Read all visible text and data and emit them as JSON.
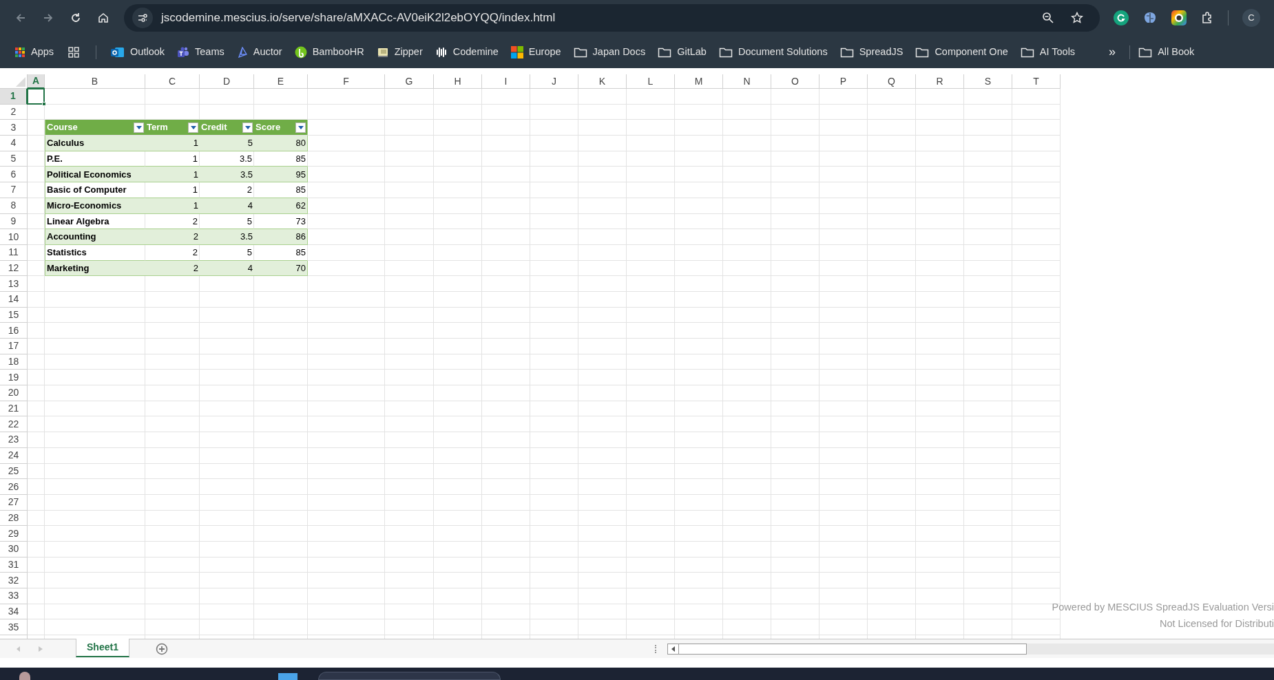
{
  "browser": {
    "url": "jscodemine.mescius.io/serve/share/aMXACc-AV0eiK2l2ebOYQQ/index.html",
    "back_disabled": true,
    "profile": "C",
    "bookmarks": [
      {
        "label": "Apps",
        "kind": "apps"
      },
      {
        "kind": "grid"
      },
      {
        "kind": "separator"
      },
      {
        "label": "Outlook",
        "kind": "outlook"
      },
      {
        "label": "Teams",
        "kind": "teams"
      },
      {
        "label": "Auctor",
        "kind": "auctor"
      },
      {
        "label": "BambooHR",
        "kind": "bamboo"
      },
      {
        "label": "Zipper",
        "kind": "zipper"
      },
      {
        "label": "Codemine",
        "kind": "codemine"
      },
      {
        "label": "Europe",
        "kind": "windows"
      },
      {
        "label": "Japan Docs",
        "kind": "folder"
      },
      {
        "label": "GitLab",
        "kind": "folder"
      },
      {
        "label": "Document Solutions",
        "kind": "folder"
      },
      {
        "label": "SpreadJS",
        "kind": "folder"
      },
      {
        "label": "Component One",
        "kind": "folder"
      },
      {
        "label": "AI Tools",
        "kind": "folder"
      }
    ],
    "more": "»",
    "all_bookmarks": "All Book"
  },
  "sheet": {
    "columns": [
      {
        "label": "A",
        "selected": true
      },
      {
        "label": "B",
        "selected": false
      },
      {
        "label": "C",
        "selected": false
      },
      {
        "label": "D",
        "selected": false
      },
      {
        "label": "E",
        "selected": false
      },
      {
        "label": "F",
        "selected": false
      },
      {
        "label": "G",
        "selected": false
      },
      {
        "label": "H",
        "selected": false
      },
      {
        "label": "I",
        "selected": false
      },
      {
        "label": "J",
        "selected": false
      },
      {
        "label": "K",
        "selected": false
      },
      {
        "label": "L",
        "selected": false
      },
      {
        "label": "M",
        "selected": false
      },
      {
        "label": "N",
        "selected": false
      },
      {
        "label": "O",
        "selected": false
      },
      {
        "label": "P",
        "selected": false
      },
      {
        "label": "Q",
        "selected": false
      },
      {
        "label": "R",
        "selected": false
      },
      {
        "label": "S",
        "selected": false
      },
      {
        "label": "T",
        "selected": false
      }
    ],
    "rows": [
      {
        "label": "1",
        "selected": true
      },
      {
        "label": "2",
        "selected": false
      },
      {
        "label": "3",
        "selected": false
      },
      {
        "label": "4",
        "selected": false
      },
      {
        "label": "5",
        "selected": false
      },
      {
        "label": "6",
        "selected": false
      },
      {
        "label": "7",
        "selected": false
      },
      {
        "label": "8",
        "selected": false
      },
      {
        "label": "9",
        "selected": false
      },
      {
        "label": "10",
        "selected": false
      },
      {
        "label": "11",
        "selected": false
      },
      {
        "label": "12",
        "selected": false
      },
      {
        "label": "13",
        "selected": false
      },
      {
        "label": "14",
        "selected": false
      },
      {
        "label": "15",
        "selected": false
      },
      {
        "label": "16",
        "selected": false
      },
      {
        "label": "17",
        "selected": false
      },
      {
        "label": "18",
        "selected": false
      },
      {
        "label": "19",
        "selected": false
      },
      {
        "label": "20",
        "selected": false
      },
      {
        "label": "21",
        "selected": false
      },
      {
        "label": "22",
        "selected": false
      },
      {
        "label": "23",
        "selected": false
      },
      {
        "label": "24",
        "selected": false
      },
      {
        "label": "25",
        "selected": false
      },
      {
        "label": "26",
        "selected": false
      },
      {
        "label": "27",
        "selected": false
      },
      {
        "label": "28",
        "selected": false
      },
      {
        "label": "29",
        "selected": false
      },
      {
        "label": "30",
        "selected": false
      },
      {
        "label": "31",
        "selected": false
      },
      {
        "label": "32",
        "selected": false
      },
      {
        "label": "33",
        "selected": false
      },
      {
        "label": "34",
        "selected": false
      },
      {
        "label": "35",
        "selected": false
      }
    ],
    "table": {
      "columns": [
        "Course",
        "Term",
        "Credit",
        "Score"
      ],
      "rows": [
        [
          "Calculus",
          "1",
          "5",
          "80"
        ],
        [
          "P.E.",
          "1",
          "3.5",
          "85"
        ],
        [
          "Political Economics",
          "1",
          "3.5",
          "95"
        ],
        [
          "Basic of Computer",
          "1",
          "2",
          "85"
        ],
        [
          "Micro-Economics",
          "1",
          "4",
          "62"
        ],
        [
          "Linear Algebra",
          "2",
          "5",
          "73"
        ],
        [
          "Accounting",
          "2",
          "3.5",
          "86"
        ],
        [
          "Statistics",
          "2",
          "5",
          "85"
        ],
        [
          "Marketing",
          "2",
          "4",
          "70"
        ]
      ]
    },
    "notice": [
      "Powered by MESCIUS SpreadJS Evaluation Versi",
      "Not Licensed for Distributi"
    ],
    "sheet_tabs": [
      {
        "label": "Sheet1",
        "selected": true
      }
    ]
  }
}
